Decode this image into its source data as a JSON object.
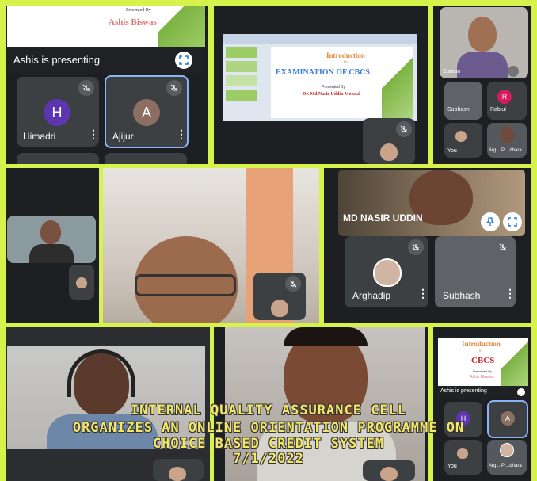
{
  "cell1": {
    "slide_presented_by": "Presented By",
    "slide_name": "Ashis Biswas",
    "presenting_label": "Ashis is presenting",
    "participants": [
      {
        "initial": "H",
        "name": "Himadri",
        "color": "#5e35b1"
      },
      {
        "initial": "A",
        "name": "Ajijur",
        "color": "#8d6e63"
      }
    ]
  },
  "cell2": {
    "slide_intro": "Introduction",
    "slide_to": "to",
    "slide_title": "EXAMINATION OF CBCS",
    "slide_presented_by": "Presented By",
    "slide_presenter": "Dr. Md Nasir Uddin Mondal"
  },
  "cell3": {
    "tiles": [
      {
        "name": "Suman"
      },
      {
        "name": "Subhash"
      },
      {
        "initial": "R",
        "name": "Rabiul",
        "color": "#d81b60"
      },
      {
        "name": "You"
      },
      {
        "name": "Arg... Pi...dhara"
      }
    ]
  },
  "cell5": {
    "speaker_name": "MD NASIR UDDIN",
    "tiles": [
      {
        "name": "Arghadip"
      },
      {
        "name": "Subhash"
      }
    ]
  },
  "cell9": {
    "slide_intro": "Introduction",
    "slide_to": "to",
    "slide_title": "CBCS",
    "slide_presented_by": "Presented By",
    "slide_name": "Ashis Biswas",
    "presenting_label": "Ashis is presenting",
    "tiles": [
      {
        "initial": "H",
        "color": "#5e35b1"
      },
      {
        "initial": "A",
        "color": "#8d6e63"
      },
      {
        "name": "You"
      },
      {
        "name": "Arg... Pi...dhara"
      }
    ]
  },
  "overlay": {
    "line1": "INTERNAL QUALITY ASSURANCE CELL",
    "line2": "ORGANIZES AN ONLINE ORIENTATION PROGRAMME ON",
    "line3": "CHOICE BASED CREDIT SYSTEM",
    "line4": "7/1/2022"
  },
  "colors": {
    "border": "#d7f24a",
    "meet_bg": "#1e1f22",
    "tile_bg": "#3c4043",
    "overlay_text": "#f3e76a"
  }
}
